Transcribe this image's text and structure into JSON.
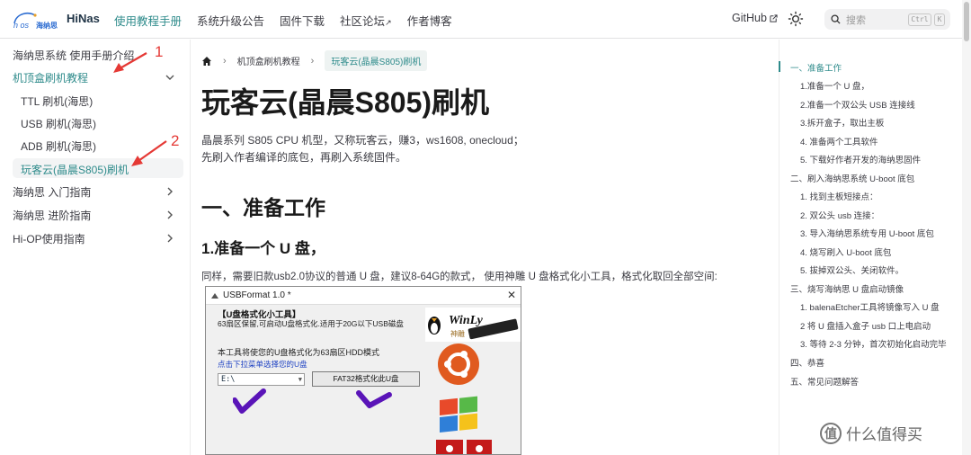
{
  "brand": {
    "name": "HiNas",
    "logo_text": "n os",
    "logo_cn": "海纳思"
  },
  "nav": {
    "links": [
      "使用教程手册",
      "系统升级公告",
      "固件下载",
      "社区论坛",
      "作者博客"
    ],
    "external_marks": [
      "",
      "",
      "",
      "↗",
      ""
    ],
    "github": "GitHub",
    "search_placeholder": "搜索",
    "kbd_ctrl": "Ctrl",
    "kbd_k": "K"
  },
  "sidebar": {
    "items": [
      {
        "label": "海纳思系统 使用手册介绍"
      },
      {
        "label": "机顶盒刷机教程",
        "expanded": true
      },
      {
        "label": "TTL 刷机(海思)"
      },
      {
        "label": "USB 刷机(海思)"
      },
      {
        "label": "ADB 刷机(海思)"
      },
      {
        "label": "玩客云(晶晨S805)刷机",
        "active": true
      },
      {
        "label": "海纳思 入门指南"
      },
      {
        "label": "海纳思 进阶指南"
      },
      {
        "label": "Hi-OP使用指南"
      }
    ],
    "annotations": [
      "1",
      "2"
    ]
  },
  "breadcrumb": {
    "items": [
      "机顶盒刷机教程",
      "玩客云(晶晨S805)刷机"
    ],
    "sep": "›"
  },
  "article": {
    "title": "玩客云(晶晨S805)刷机",
    "intro_lines": [
      "晶晨系列 S805 CPU 机型，又称玩客云，赚3，ws1608, onecloud；",
      "先刷入作者编译的底包，再刷入系统固件。"
    ],
    "h2": "一、准备工作",
    "h3": "1.准备一个 U 盘，",
    "para": "同样，需要旧款usb2.0协议的普通 U 盘，建议8-64G的款式， 使用神雕 U 盘格式化小工具，格式化取回全部空间:"
  },
  "app_screenshot": {
    "window_title": "USBFormat 1.0 *",
    "close": "✕",
    "heading": "【U盘格式化小工具】",
    "desc": "63扇区保留,可启动U盘格式化.适用于20G以下USB磁盘",
    "line1": "本工具将使您的U盘格式化为63扇区HDD模式",
    "line2": "点击下拉菜单选择您的U盘",
    "drive_value": "E:\\",
    "format_button": "FAT32格式化此U盘",
    "brand": "WinLy",
    "brand_cn": "神雕"
  },
  "toc": {
    "items": [
      {
        "label": "一、准备工作",
        "level": 1,
        "active": true
      },
      {
        "label": "1.准备一个 U 盘，",
        "level": 2
      },
      {
        "label": "2.准备一个双公头 USB 连接线",
        "level": 2
      },
      {
        "label": "3.拆开盒子，取出主板",
        "level": 2
      },
      {
        "label": "4. 准备两个工具软件",
        "level": 2
      },
      {
        "label": "5. 下载好作者开发的海纳思固件",
        "level": 2
      },
      {
        "label": "二、刷入海纳思系统 U-boot 底包",
        "level": 1
      },
      {
        "label": "1. 找到主板短接点：",
        "level": 2
      },
      {
        "label": "2. 双公头 usb 连接：",
        "level": 2
      },
      {
        "label": "3. 导入海纳思系统专用 U-boot 底包",
        "level": 2
      },
      {
        "label": "4. 烧写刷入 U-boot 底包",
        "level": 2
      },
      {
        "label": "5. 拔掉双公头、关闭软件。",
        "level": 2
      },
      {
        "label": "三、烧写海纳思 U 盘启动镜像",
        "level": 1
      },
      {
        "label": "1. balenaEtcher工具将镜像写入 U 盘",
        "level": 2
      },
      {
        "label": "2 将 U 盘插入盒子 usb 口上电启动",
        "level": 2
      },
      {
        "label": "3. 等待 2-3 分钟，首次初始化启动完毕",
        "level": 2
      },
      {
        "label": "四、恭喜",
        "level": 1
      },
      {
        "label": "五、常见问题解答",
        "level": 1
      }
    ]
  },
  "watermark": {
    "mark": "值",
    "text": "什么值得买"
  },
  "colors": {
    "accent": "#2e8b8b",
    "annotation": "#e53935"
  }
}
